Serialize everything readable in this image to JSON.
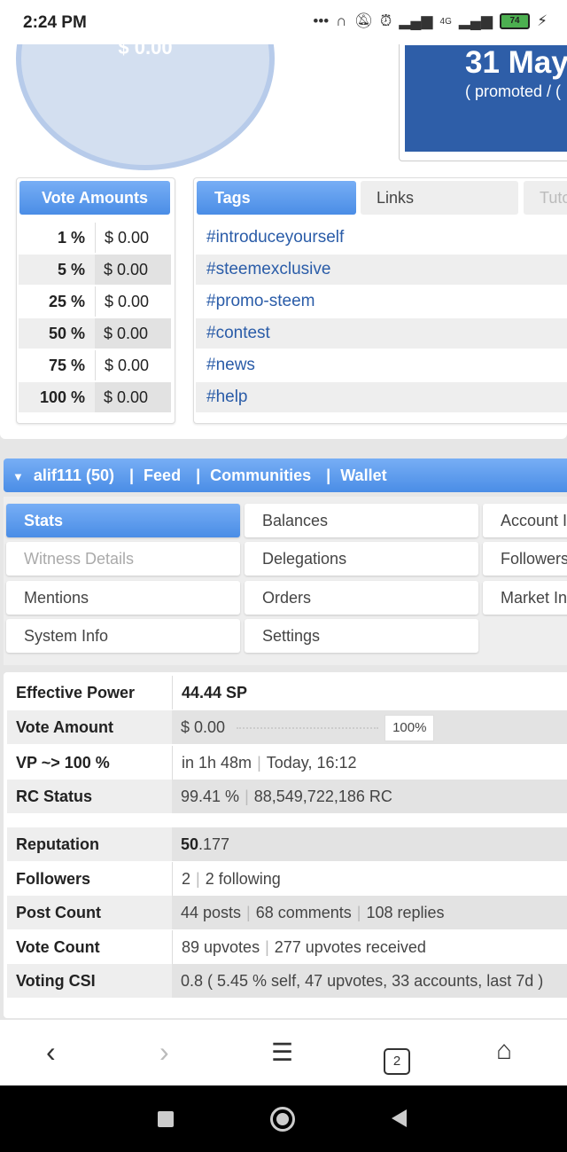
{
  "status_bar": {
    "time": "2:24 PM",
    "network": "4G",
    "battery": "74"
  },
  "top_card": {
    "gauge_value": "$ 0.00",
    "date_big": "31 May",
    "date_small": "( promoted / ("
  },
  "vote_amounts": {
    "title": "Vote Amounts",
    "rows": [
      {
        "pct": "1 %",
        "amount": "$ 0.00"
      },
      {
        "pct": "5 %",
        "amount": "$ 0.00"
      },
      {
        "pct": "25 %",
        "amount": "$ 0.00"
      },
      {
        "pct": "50 %",
        "amount": "$ 0.00"
      },
      {
        "pct": "75 %",
        "amount": "$ 0.00"
      },
      {
        "pct": "100 %",
        "amount": "$ 0.00"
      }
    ]
  },
  "tags_panel": {
    "tab_tags": "Tags",
    "tab_links": "Links",
    "tab_tuto": "Tuto",
    "tags": [
      "#introduceyourself",
      "#steemexclusive",
      "#promo-steem",
      "#contest",
      "#news",
      "#help"
    ]
  },
  "user_nav": {
    "user": "alif111 (50)",
    "sep": "|",
    "feed": "Feed",
    "communities": "Communities",
    "wallet": "Wallet"
  },
  "tabs": {
    "stats": "Stats",
    "balances": "Balances",
    "account": "Account I",
    "witness": "Witness Details",
    "delegations": "Delegations",
    "followers": "Followers",
    "mentions": "Mentions",
    "orders": "Orders",
    "market": "Market In",
    "system": "System Info",
    "settings": "Settings"
  },
  "stats": {
    "effective_power_label": "Effective Power",
    "effective_power_value": "44.44 SP",
    "vote_amount_label": "Vote Amount",
    "vote_amount_value": "$ 0.00",
    "vote_amount_pct": "100%",
    "vp_label": "VP ~> 100 %",
    "vp_time": "in 1h 48m",
    "vp_when": "Today, 16:12",
    "rc_label": "RC Status",
    "rc_pct": "99.41 %",
    "rc_amount": "88,549,722,186 RC",
    "reputation_label": "Reputation",
    "reputation_int": "50",
    "reputation_dec": ".177",
    "followers_label": "Followers",
    "followers_count": "2",
    "following": "2 following",
    "post_count_label": "Post Count",
    "posts": "44 posts",
    "comments": "68 comments",
    "replies": "108 replies",
    "vote_count_label": "Vote Count",
    "upvotes": "89 upvotes",
    "upvotes_received": "277 upvotes received",
    "csi_label": "Voting CSI",
    "csi_value": "0.8 ( 5.45 % self, 47 upvotes, 33 accounts, last 7d )"
  },
  "bottom_nav": {
    "tab_count": "2"
  }
}
